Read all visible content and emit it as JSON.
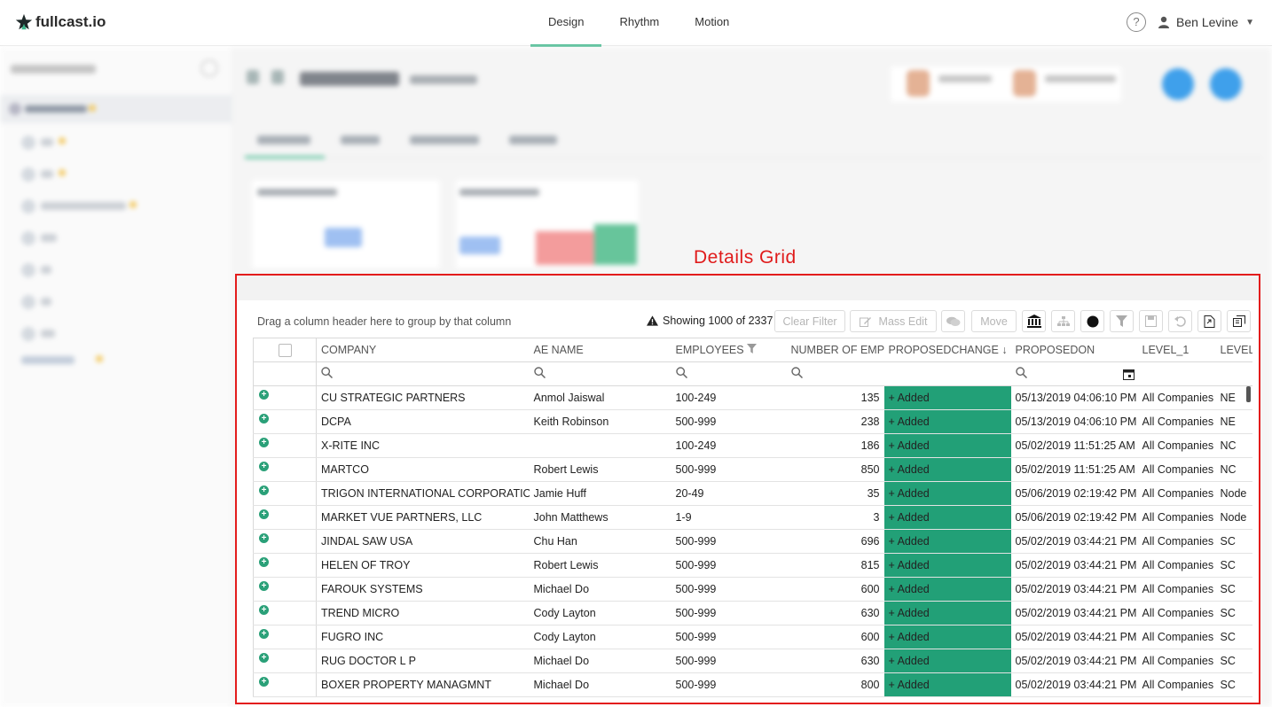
{
  "brand": {
    "logo_text": "fullcast.io",
    "accent": "#3bb68a"
  },
  "nav": {
    "items": [
      {
        "label": "Design",
        "active": true
      },
      {
        "label": "Rhythm",
        "active": false
      },
      {
        "label": "Motion",
        "active": false
      }
    ]
  },
  "user": {
    "help_glyph": "?",
    "name": "Ben Levine"
  },
  "annotation": {
    "label": "Details Grid",
    "color": "#e31c1c"
  },
  "grid": {
    "group_hint": "Drag a column header here to group by that column",
    "showing": "Showing 1000 of 2337",
    "toolbar": {
      "clear_filter": "Clear Filter",
      "mass_edit": "Mass Edit",
      "move": "Move"
    },
    "columns": [
      "COMPANY",
      "AE NAME",
      "EMPLOYEES",
      "NUMBER OF EMP",
      "PROPOSEDCHANGE",
      "PROPOSEDON",
      "LEVEL_1",
      "LEVEL"
    ],
    "rows": [
      [
        "CU STRATEGIC PARTNERS",
        "Anmol Jaiswal",
        "100-249",
        "135",
        "+ Added",
        "05/13/2019 04:06:10 PM",
        "All Companies",
        "NE"
      ],
      [
        "DCPA",
        "Keith Robinson",
        "500-999",
        "238",
        "+ Added",
        "05/13/2019 04:06:10 PM",
        "All Companies",
        "NE"
      ],
      [
        "X-RITE INC",
        "",
        "100-249",
        "186",
        "+ Added",
        "05/02/2019 11:51:25 AM",
        "All Companies",
        "NC"
      ],
      [
        "MARTCO",
        "Robert Lewis",
        "500-999",
        "850",
        "+ Added",
        "05/02/2019 11:51:25 AM",
        "All Companies",
        "NC"
      ],
      [
        "TRIGON INTERNATIONAL CORPORATION",
        "Jamie Huff",
        "20-49",
        "35",
        "+ Added",
        "05/06/2019 02:19:42 PM",
        "All Companies",
        "Node"
      ],
      [
        "MARKET VUE PARTNERS, LLC",
        "John Matthews",
        "1-9",
        "3",
        "+ Added",
        "05/06/2019 02:19:42 PM",
        "All Companies",
        "Node"
      ],
      [
        "JINDAL SAW USA",
        "Chu Han",
        "500-999",
        "696",
        "+ Added",
        "05/02/2019 03:44:21 PM",
        "All Companies",
        "SC"
      ],
      [
        "HELEN OF TROY",
        "Robert Lewis",
        "500-999",
        "815",
        "+ Added",
        "05/02/2019 03:44:21 PM",
        "All Companies",
        "SC"
      ],
      [
        "FAROUK SYSTEMS",
        "Michael Do",
        "500-999",
        "600",
        "+ Added",
        "05/02/2019 03:44:21 PM",
        "All Companies",
        "SC"
      ],
      [
        "TREND MICRO",
        "Cody Layton",
        "500-999",
        "630",
        "+ Added",
        "05/02/2019 03:44:21 PM",
        "All Companies",
        "SC"
      ],
      [
        "FUGRO INC",
        "Cody Layton",
        "500-999",
        "600",
        "+ Added",
        "05/02/2019 03:44:21 PM",
        "All Companies",
        "SC"
      ],
      [
        "RUG DOCTOR L P",
        "Michael Do",
        "500-999",
        "630",
        "+ Added",
        "05/02/2019 03:44:21 PM",
        "All Companies",
        "SC"
      ],
      [
        "BOXER PROPERTY MANAGMNT",
        "Michael Do",
        "500-999",
        "800",
        "+ Added",
        "05/02/2019 03:44:21 PM",
        "All Companies",
        "SC"
      ]
    ],
    "added_color": "#22a077"
  }
}
